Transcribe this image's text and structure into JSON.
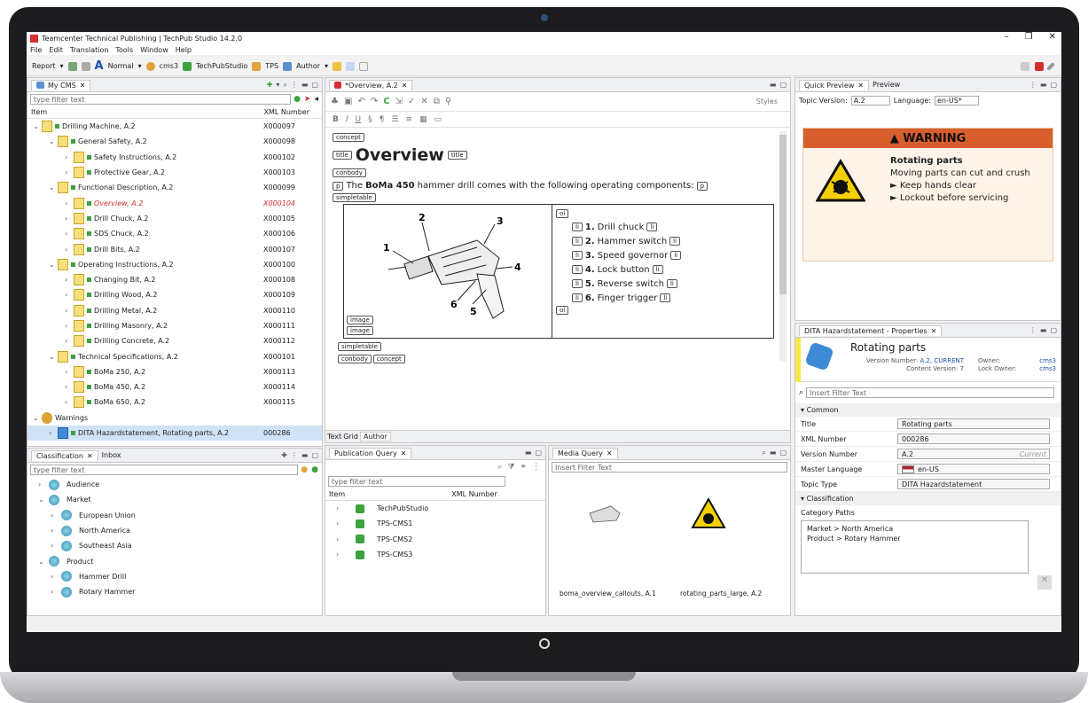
{
  "window": {
    "title": "Teamcenter Technical Publishing | TechPub Studio 14.2.0"
  },
  "menu": [
    "File",
    "Edit",
    "Translation",
    "Tools",
    "Window",
    "Help"
  ],
  "toolbar": {
    "report": "Report",
    "style": "Normal",
    "user": "cms3",
    "studio": "TechPubStudio",
    "tps": "TPS",
    "author": "Author"
  },
  "my_cms": {
    "tab": "My CMS",
    "filter_placeholder": "type filter text",
    "col_item": "Item",
    "col_xml": "XML Number",
    "rows": [
      {
        "label": "Drilling Machine, A.2",
        "xml": "X000097",
        "indent": 0,
        "arrow": "open"
      },
      {
        "label": "General Safety, A.2",
        "xml": "X000098",
        "indent": 1,
        "arrow": "open"
      },
      {
        "label": "Safety Instructions, A.2",
        "xml": "X000102",
        "indent": 2,
        "arrow": "closed"
      },
      {
        "label": "Protective Gear, A.2",
        "xml": "X000103",
        "indent": 2,
        "arrow": "closed"
      },
      {
        "label": "Functional Description, A.2",
        "xml": "X000099",
        "indent": 1,
        "arrow": "open"
      },
      {
        "label": "Overview, A.2",
        "xml": "X000104",
        "indent": 2,
        "arrow": "closed",
        "red": true
      },
      {
        "label": "Drill Chuck, A.2",
        "xml": "X000105",
        "indent": 2,
        "arrow": "closed"
      },
      {
        "label": "SDS Chuck, A.2",
        "xml": "X000106",
        "indent": 2,
        "arrow": "closed"
      },
      {
        "label": "Drill Bits, A.2",
        "xml": "X000107",
        "indent": 2,
        "arrow": "closed"
      },
      {
        "label": "Operating Instructions, A.2",
        "xml": "X000100",
        "indent": 1,
        "arrow": "open"
      },
      {
        "label": "Changing Bit, A.2",
        "xml": "X000108",
        "indent": 2,
        "arrow": "closed"
      },
      {
        "label": "Drilling Wood, A.2",
        "xml": "X000109",
        "indent": 2,
        "arrow": "closed"
      },
      {
        "label": "Drilling Metal, A.2",
        "xml": "X000110",
        "indent": 2,
        "arrow": "closed"
      },
      {
        "label": "Drilling Masonry, A.2",
        "xml": "X000111",
        "indent": 2,
        "arrow": "closed"
      },
      {
        "label": "Drilling Concrete, A.2",
        "xml": "X000112",
        "indent": 2,
        "arrow": "closed"
      },
      {
        "label": "Technical Specifications, A.2",
        "xml": "X000101",
        "indent": 1,
        "arrow": "open"
      },
      {
        "label": "BoMa 250, A.2",
        "xml": "X000113",
        "indent": 2,
        "arrow": "closed"
      },
      {
        "label": "BoMa 450, A.2",
        "xml": "X000114",
        "indent": 2,
        "arrow": "closed"
      },
      {
        "label": "BoMa 650, A.2",
        "xml": "X000115",
        "indent": 2,
        "arrow": "closed"
      },
      {
        "label": "Warnings",
        "xml": "",
        "indent": 0,
        "arrow": "open"
      },
      {
        "label": "DITA Hazardstatement, Rotating parts, A.2",
        "xml": "000286",
        "indent": 1,
        "arrow": "closed",
        "selected": true
      }
    ]
  },
  "classification": {
    "tab1": "Classification",
    "tab2": "Inbox",
    "filter_placeholder": "type filter text",
    "rows": [
      {
        "label": "Audience",
        "indent": 0,
        "arrow": "closed"
      },
      {
        "label": "Market",
        "indent": 0,
        "arrow": "open"
      },
      {
        "label": "European Union",
        "indent": 1,
        "arrow": "closed"
      },
      {
        "label": "North America",
        "indent": 1,
        "arrow": "closed"
      },
      {
        "label": "Southeast Asia",
        "indent": 1,
        "arrow": "closed"
      },
      {
        "label": "Product",
        "indent": 0,
        "arrow": "open"
      },
      {
        "label": "Hammer Drill",
        "indent": 1,
        "arrow": "closed"
      },
      {
        "label": "Rotary Hammer",
        "indent": 1,
        "arrow": "closed"
      }
    ]
  },
  "editor": {
    "tab": "*Overview, A.2",
    "styles": "Styles",
    "tag_concept": "concept",
    "tag_title": "title",
    "title": "Overview",
    "tag_conbody": "conbody",
    "tag_p": "p",
    "para_pre": "The",
    "para_bold": "BoMa 450",
    "para_post": "hammer drill comes with the following operating components:",
    "tag_simpletable": "simpletable",
    "tag_ol": "ol",
    "tag_li": "li",
    "tag_image": "image",
    "callouts": [
      "1",
      "2",
      "3",
      "4",
      "5",
      "6"
    ],
    "list": [
      {
        "num": "1.",
        "text": "Drill chuck"
      },
      {
        "num": "2.",
        "text": "Hammer switch"
      },
      {
        "num": "3.",
        "text": "Speed governor"
      },
      {
        "num": "4.",
        "text": "Lock button"
      },
      {
        "num": "5.",
        "text": "Reverse switch"
      },
      {
        "num": "6.",
        "text": "Finger trigger"
      }
    ],
    "bottom_tabs": [
      "Text",
      "Grid",
      "Author"
    ]
  },
  "quick_preview": {
    "tab1": "Quick Preview",
    "tab2": "Preview",
    "topic_version_label": "Topic Version:",
    "topic_version": "A.2",
    "language_label": "Language:",
    "language": "en-US*",
    "warning_head": "WARNING",
    "warning_title": "Rotating parts",
    "warning_text": "Moving parts can cut and crush",
    "bullets": [
      "Keep hands clear",
      "Lockout before servicing"
    ]
  },
  "properties": {
    "tab": "DITA Hazardstatement - Properties",
    "title": "Rotating parts",
    "version_number_label": "Version Number:",
    "version_number": "A.2, CURRENT",
    "content_version_label": "Content Version:",
    "content_version": "7",
    "owner_label": "Owner:",
    "owner": "cms3",
    "lock_owner_label": "Lock Owner:",
    "lock_owner": "cms3",
    "filter_placeholder": "Insert Filter Text",
    "common_label": "Common",
    "fields": [
      {
        "k": "Title",
        "v": "Rotating parts"
      },
      {
        "k": "XML Number",
        "v": "000286"
      },
      {
        "k": "Version Number",
        "v": "A.2",
        "extra": "Current"
      },
      {
        "k": "Master Language",
        "v": "en-US"
      },
      {
        "k": "Topic Type",
        "v": "DITA Hazardstatement"
      }
    ],
    "classification_label": "Classification",
    "category_paths_label": "Category Paths",
    "paths": [
      "Market > North America",
      "Product > Rotary Hammer"
    ]
  },
  "pub_query": {
    "tab": "Publication Query",
    "filter_placeholder": "type filter text",
    "col_item": "Item",
    "col_xml": "XML Number",
    "rows": [
      "TechPubStudio",
      "TPS-CMS1",
      "TPS-CMS2",
      "TPS-CMS3"
    ]
  },
  "media_query": {
    "tab": "Media Query",
    "filter_placeholder": "Insert Filter Text",
    "items": [
      "boma_overview_callouts, A.1",
      "rotating_parts_large, A.2"
    ]
  },
  "colors": {
    "accent": "#d95e2e",
    "selection": "#cfe3f7",
    "red": "#d32f2f"
  }
}
